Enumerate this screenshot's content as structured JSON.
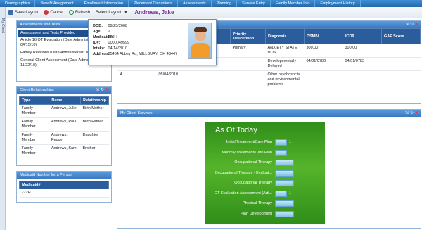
{
  "top_tabs": [
    "Demographics",
    "Benefit Assignment",
    "Enrollment Information",
    "Placement Disruptions",
    "Assessments",
    "Planning",
    "Service Entry",
    "Family Member Info",
    "Employment History"
  ],
  "vertical_tab": "My Client",
  "toolbar": {
    "save_label": "Save Layout",
    "cancel_label": "Cancel",
    "refresh_label": "Refresh",
    "select_layout_label": "Select Layout",
    "client_name": "Andrews, Jake"
  },
  "assessments_panel": {
    "title": "Assessments and Tests",
    "subheader": "Assessment and Tests Provided",
    "items": [
      "Article 16 OT Evaluation (Date Administered: 04/15/10)",
      "Family Relations (Date Administered: 10/10/09)",
      "General Client Assessment (Date Administered: 11/22/10)"
    ]
  },
  "relationships_panel": {
    "title": "Client Relationships",
    "columns": [
      "Type",
      "Name",
      "Relationship"
    ],
    "rows": [
      [
        "Family Member",
        "Andrews, Julie",
        "Birth Mother"
      ],
      [
        "Family Member",
        "Andrews, Paul",
        "Birth Father"
      ],
      [
        "Family Member",
        "Andrews, Peggy",
        "Daughter"
      ],
      [
        "Family Member",
        "Andrews, Sam",
        "Brother"
      ]
    ]
  },
  "medicaid_panel": {
    "title": "Medicaid Number for a Person",
    "column": "Medicaid#",
    "value": "222H"
  },
  "popup": {
    "fields": [
      {
        "label": "DOB:",
        "value": "09/25/2008"
      },
      {
        "label": "Age:",
        "value": "2"
      },
      {
        "label": "Medicaid#:",
        "value": "222H"
      },
      {
        "label": "ID#:",
        "value": "0000049599"
      },
      {
        "label": "Intake:",
        "value": "04/14/2010"
      },
      {
        "label": "Address:",
        "value": "25454 Abbey Rd, MILLBURY, OH 43447"
      }
    ]
  },
  "diagnosis_panel": {
    "columns": [
      "",
      "",
      "Priority Description",
      "Diagnosis",
      "DSMIV",
      "ICD9",
      "GAF Score"
    ],
    "rows": [
      [
        "",
        "",
        "Primary",
        "ANXIETY STATE NOS",
        "300.00",
        "300.00",
        ""
      ],
      [
        "",
        "",
        "",
        "Developmentally Delayed",
        "04/01/0783",
        "04/01/0783",
        ""
      ],
      [
        "4",
        "05/04/2010",
        "",
        "Other psychosocial and environmental problems",
        "",
        "",
        ""
      ]
    ]
  },
  "services_panel": {
    "title": "My Client Services",
    "heading": "As Of Today"
  },
  "chart_data": {
    "type": "bar",
    "title": "As Of Today",
    "categories": [
      "Initial Treatment/Care Plan",
      "Monthly Treatment/Care Plan",
      "Occupational Therapy",
      "Occupational Therapy - Evaluat...",
      "Occupational Therapy",
      "OT Evaluation Assessment (Arti...",
      "Physical Therapy",
      "Plan Development"
    ],
    "values": [
      1,
      1,
      0,
      0,
      0,
      1,
      0,
      0
    ],
    "value_labels": [
      "1",
      "1",
      "",
      "",
      "",
      "1",
      "",
      ""
    ]
  }
}
